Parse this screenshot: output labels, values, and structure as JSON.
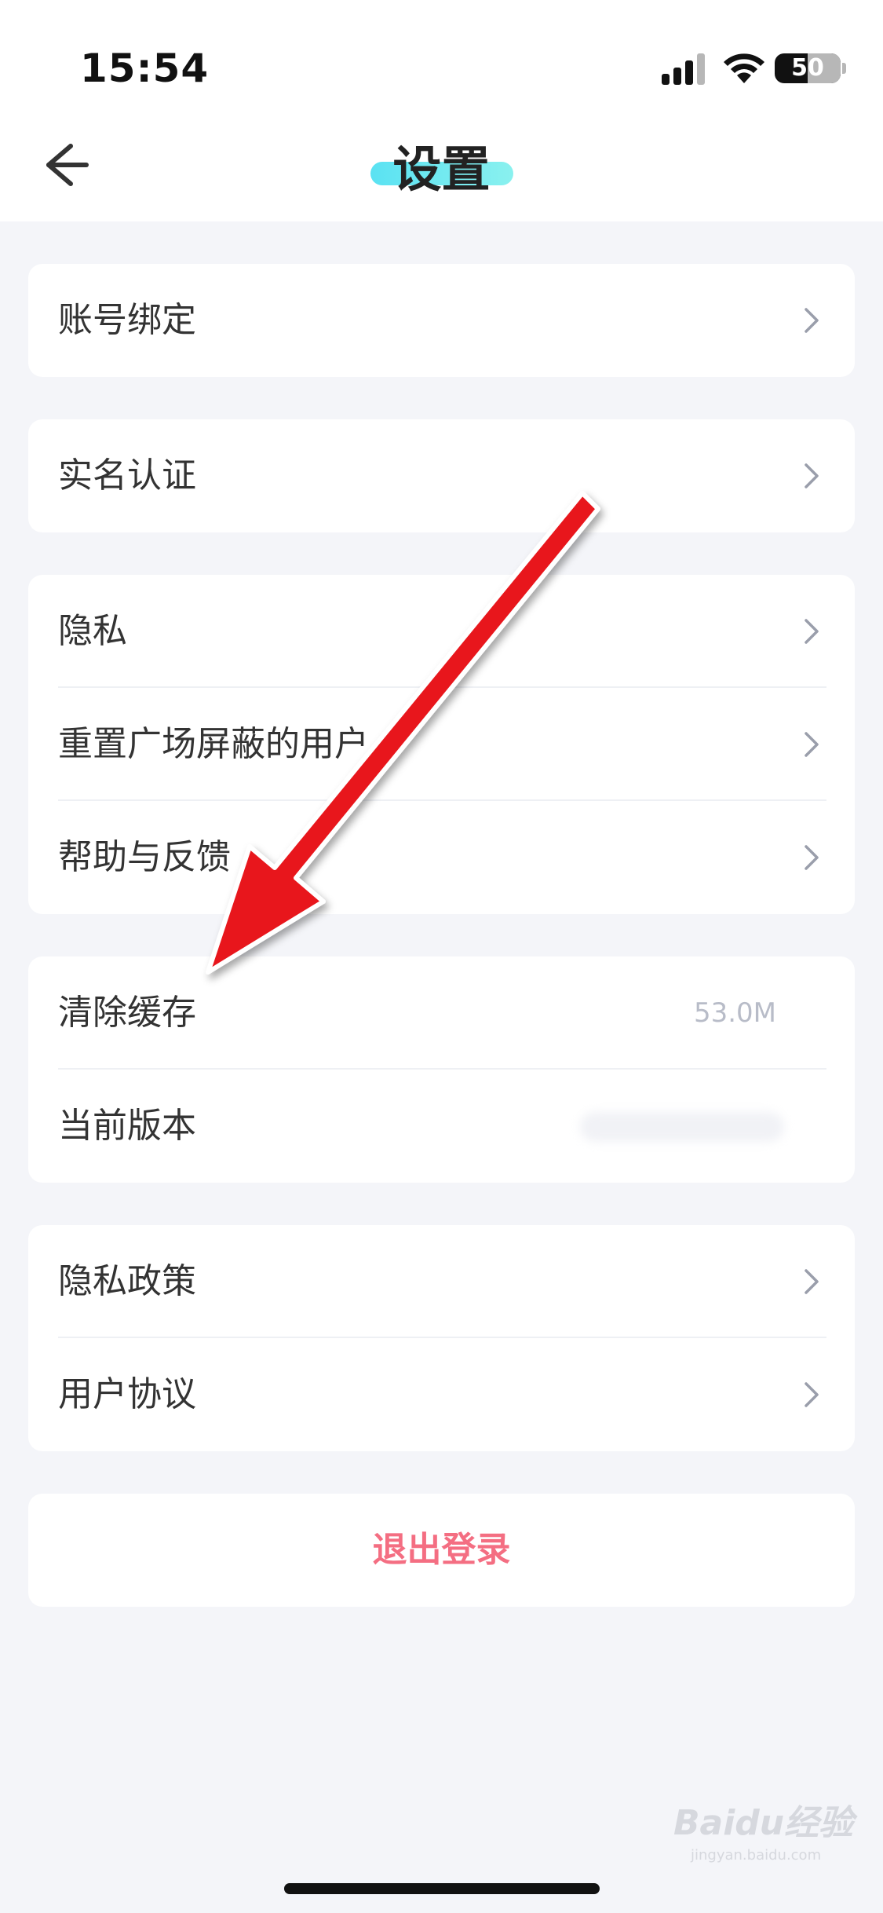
{
  "status_bar": {
    "time": "15:54",
    "battery": "50"
  },
  "header": {
    "title": "设置",
    "back_icon": "arrow-left-icon"
  },
  "sections": [
    {
      "items": [
        {
          "label": "账号绑定",
          "chevron": true
        }
      ]
    },
    {
      "items": [
        {
          "label": "实名认证",
          "chevron": true
        }
      ]
    },
    {
      "items": [
        {
          "label": "隐私",
          "chevron": true
        },
        {
          "label": "重置广场屏蔽的用户",
          "chevron": true
        },
        {
          "label": "帮助与反馈",
          "chevron": true
        }
      ]
    },
    {
      "items": [
        {
          "label": "清除缓存",
          "value": "53.0M"
        },
        {
          "label": "当前版本"
        }
      ]
    },
    {
      "items": [
        {
          "label": "隐私政策",
          "chevron": true
        },
        {
          "label": "用户协议",
          "chevron": true
        }
      ]
    }
  ],
  "logout": {
    "label": "退出登录"
  },
  "watermark": {
    "text": "Baidu经验",
    "sub": "jingyan.baidu.com"
  },
  "colors": {
    "logout": "#f46e82",
    "title_highlight": "#5ae2f2",
    "annotation_arrow": "#e8141b"
  }
}
